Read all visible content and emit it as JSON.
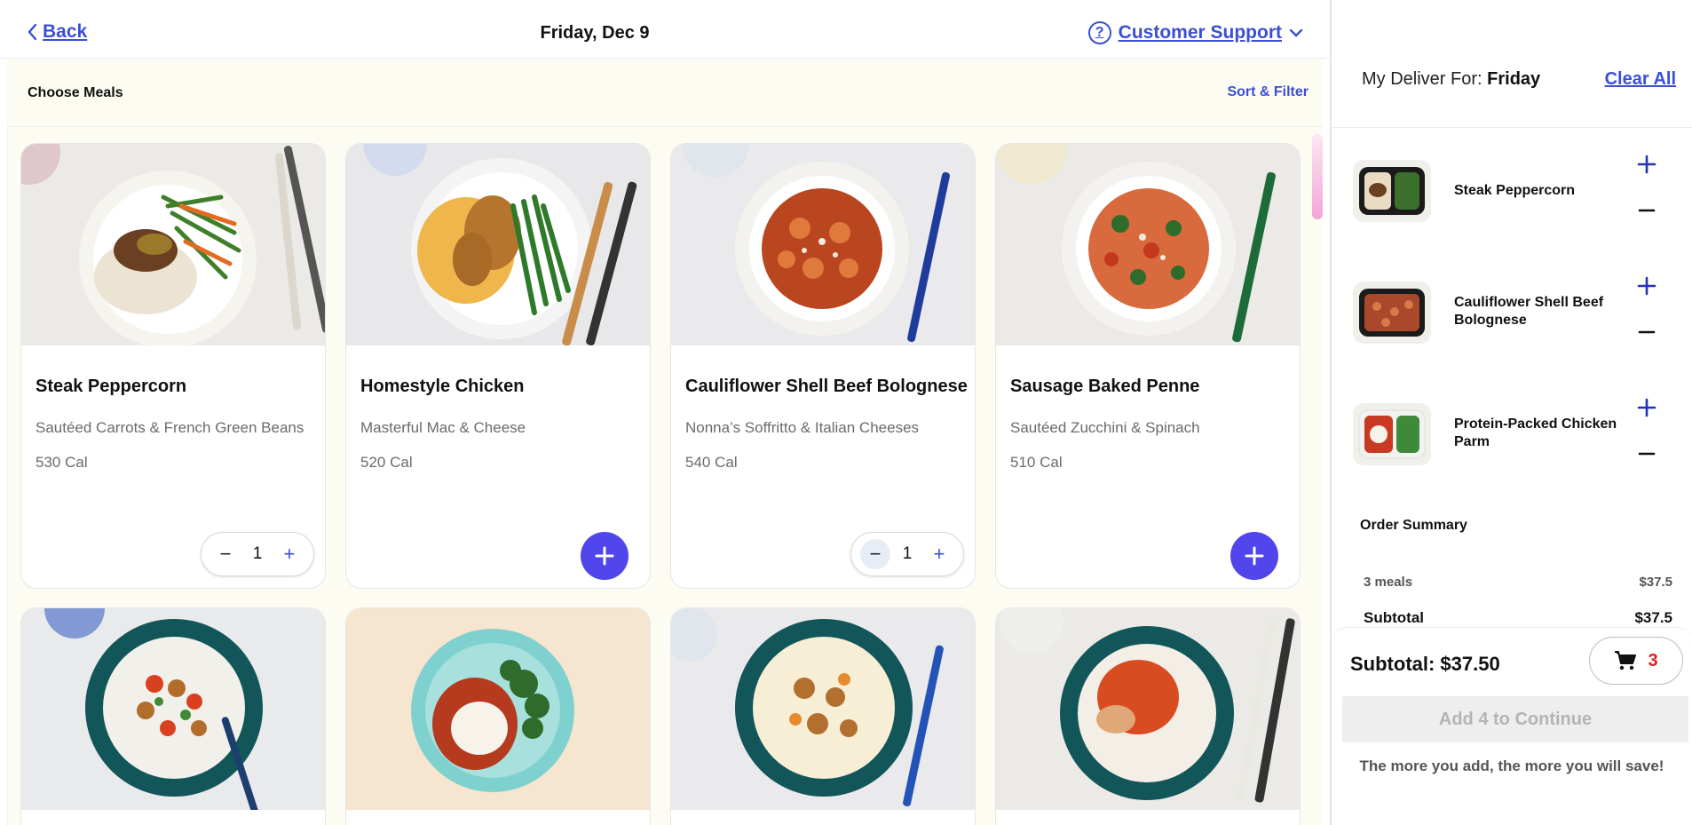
{
  "header": {
    "back_label": "Back",
    "date": "Friday, Dec 9",
    "support_label": "Customer Support"
  },
  "subheader": {
    "choose_label": "Choose Meals",
    "sort_filter_label": "Sort & Filter"
  },
  "meals": [
    {
      "name": "Steak Peppercorn",
      "side": "Sautéed Carrots & French Green Beans",
      "cal": "530 Cal",
      "qty": "1",
      "in_cart": true
    },
    {
      "name": "Homestyle Chicken",
      "side": "Masterful Mac & Cheese",
      "cal": "520 Cal",
      "in_cart": false
    },
    {
      "name": "Cauliflower Shell Beef Bolognese",
      "side": "Nonna’s Soffritto & Italian Cheeses",
      "cal": "540 Cal",
      "qty": "1",
      "in_cart": true
    },
    {
      "name": "Sausage Baked Penne",
      "side": "Sautéed Zucchini & Spinach",
      "cal": "510 Cal",
      "in_cart": false
    }
  ],
  "sidebar": {
    "deliver_prefix": "My Deliver For:",
    "deliver_day": "Friday",
    "clear_all_label": "Clear All",
    "cart_items": [
      {
        "name": "Steak Peppercorn"
      },
      {
        "name": "Cauliflower Shell Beef Bolognese"
      },
      {
        "name": "Protein-Packed Chicken Parm"
      }
    ],
    "summary_title": "Order Summary",
    "meals_count_label": "3 meals",
    "meals_price": "$37.5",
    "subtotal_label": "Subtotal",
    "subtotal_price": "$37.5",
    "footer_subtotal": "Subtotal: $37.50",
    "cart_count": "3",
    "continue_label": "Add 4 to Continue",
    "savings_note": "The more you add, the more you will save!"
  },
  "colors": {
    "accent": "#3b4fd6",
    "add_button": "#5145ec",
    "cart_count": "#e02020",
    "background_cream": "#fdfcf3"
  }
}
